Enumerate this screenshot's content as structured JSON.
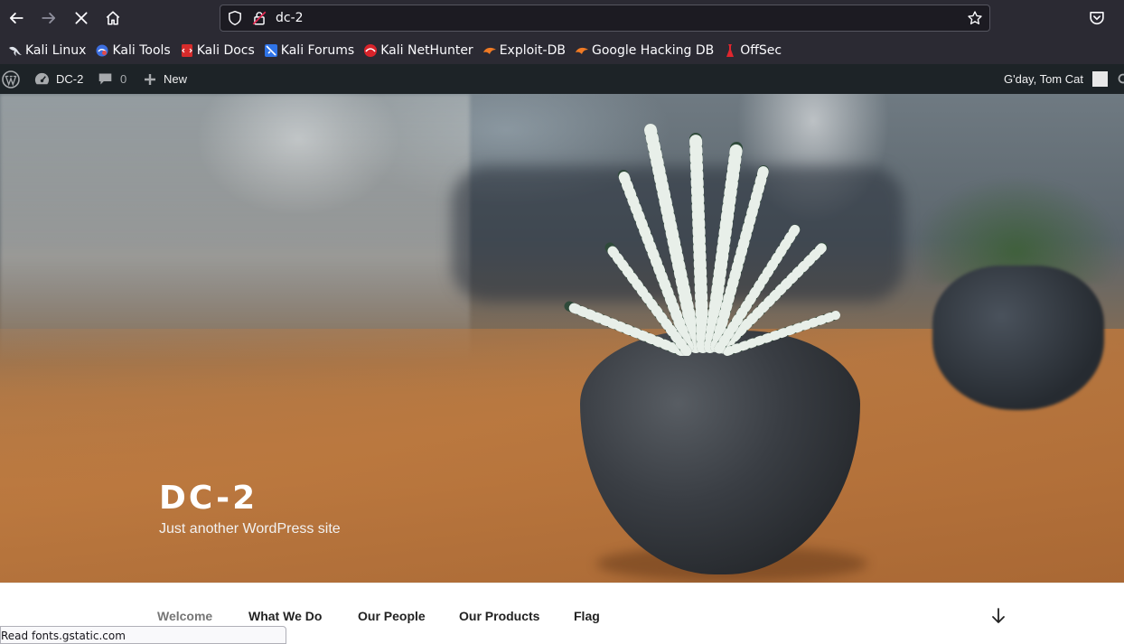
{
  "browser": {
    "url": "dc-2",
    "nav_icons": [
      "back-arrow-icon",
      "forward-arrow-icon",
      "stop-icon",
      "home-icon"
    ],
    "colors": {
      "chrome": "#2b2a33",
      "urlbar": "#1c1b22",
      "text": "#fbfbfe"
    }
  },
  "bookmarks": [
    {
      "label": "Kali Linux",
      "icon": "kali-dragon-icon"
    },
    {
      "label": "Kali Tools",
      "icon": "kali-tools-icon"
    },
    {
      "label": "Kali Docs",
      "icon": "kali-docs-icon"
    },
    {
      "label": "Kali Forums",
      "icon": "kali-forums-icon"
    },
    {
      "label": "Kali NetHunter",
      "icon": "nethunter-icon"
    },
    {
      "label": "Exploit-DB",
      "icon": "exploit-db-icon"
    },
    {
      "label": "Google Hacking DB",
      "icon": "ghdb-icon"
    },
    {
      "label": "OffSec",
      "icon": "offsec-icon"
    }
  ],
  "admin_bar": {
    "site_name": "DC-2",
    "comments_count": "0",
    "new_label": "New",
    "greeting": "G'day, Tom Cat",
    "colors": {
      "bg": "#1d2327",
      "text": "#f0f0f1",
      "muted": "#a7aaad"
    }
  },
  "site": {
    "title": "DC-2",
    "tagline": "Just another WordPress site"
  },
  "nav": {
    "items": [
      {
        "label": "Welcome",
        "current": true
      },
      {
        "label": "What We Do",
        "current": false
      },
      {
        "label": "Our People",
        "current": false
      },
      {
        "label": "Our Products",
        "current": false
      },
      {
        "label": "Flag",
        "current": false
      }
    ]
  },
  "status_bar": {
    "text": "Read fonts.gstatic.com"
  }
}
